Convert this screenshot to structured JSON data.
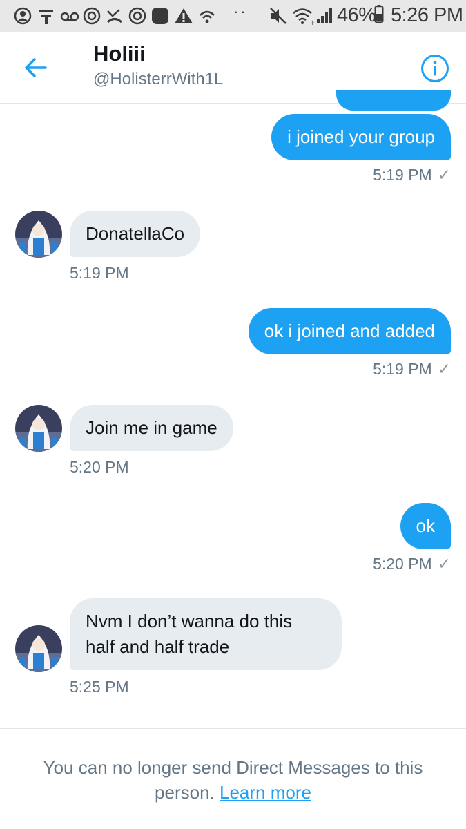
{
  "status_bar": {
    "battery": "46%",
    "time": "5:26 PM"
  },
  "header": {
    "name": "Holiii",
    "handle": "@HolisterrWith1L"
  },
  "messages": [
    {
      "direction": "out",
      "text": "i joined your group",
      "time": "5:19 PM",
      "read_check": "✓"
    },
    {
      "direction": "in",
      "text": "DonatellaCo",
      "time": "5:19 PM"
    },
    {
      "direction": "out",
      "text": "ok i joined and added",
      "time": "5:19 PM",
      "read_check": "✓"
    },
    {
      "direction": "in",
      "text": "Join me in game",
      "time": "5:20 PM"
    },
    {
      "direction": "out",
      "text": "ok",
      "time": "5:20 PM",
      "read_check": "✓"
    },
    {
      "direction": "in",
      "text_line1": "Nvm I don’t wanna do this",
      "text_line2": "half and half trade",
      "time": "5:25 PM"
    }
  ],
  "footer": {
    "notice": "You can no longer send Direct Messages to this person.",
    "link": "Learn more"
  },
  "colors": {
    "accent": "#1da1f2",
    "incoming_bubble": "#e6ecf0",
    "secondary_text": "#657786"
  }
}
